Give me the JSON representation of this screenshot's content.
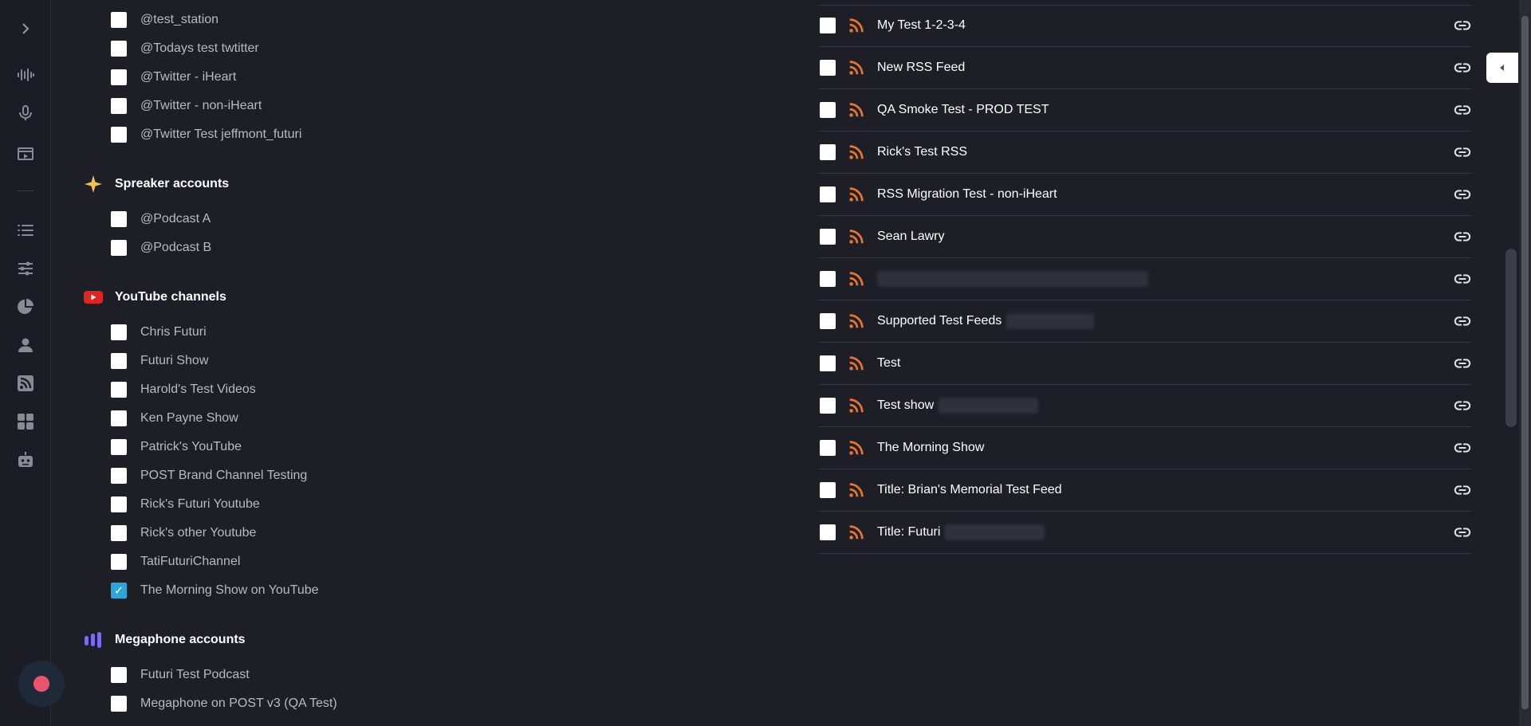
{
  "left_panel": {
    "twitter_items": [
      {
        "label": "@test_station",
        "checked": false
      },
      {
        "label": "@Todays test twtitter",
        "checked": false
      },
      {
        "label": "@Twitter - iHeart",
        "checked": false
      },
      {
        "label": "@Twitter - non-iHeart",
        "checked": false
      },
      {
        "label": "@Twitter Test jeffmont_futuri",
        "checked": false
      }
    ],
    "spreaker": {
      "title": "Spreaker accounts",
      "icon": "spreaker-star-icon",
      "items": [
        {
          "label": "@Podcast A",
          "checked": false
        },
        {
          "label": "@Podcast B",
          "checked": false
        }
      ]
    },
    "youtube": {
      "title": "YouTube channels",
      "icon": "youtube-icon",
      "items": [
        {
          "label": "Chris Futuri",
          "checked": false
        },
        {
          "label": "Futuri Show",
          "checked": false
        },
        {
          "label": "Harold's Test Videos",
          "checked": false
        },
        {
          "label": "Ken Payne Show",
          "checked": false
        },
        {
          "label": "Patrick's YouTube",
          "checked": false
        },
        {
          "label": "POST Brand Channel Testing",
          "checked": false
        },
        {
          "label": "Rick's Futuri Youtube",
          "checked": false
        },
        {
          "label": "Rick's other Youtube",
          "checked": false
        },
        {
          "label": "TatiFuturiChannel",
          "checked": false
        },
        {
          "label": "The Morning Show on YouTube",
          "checked": true
        }
      ]
    },
    "megaphone": {
      "title": "Megaphone accounts",
      "icon": "megaphone-bars-icon",
      "items": [
        {
          "label": "Futuri Test Podcast",
          "checked": false
        },
        {
          "label": "Megaphone on POST v3 (QA Test)",
          "checked": false
        }
      ]
    }
  },
  "rss_feeds": [
    {
      "name": "My Test 1-2-3-4",
      "redacted": false
    },
    {
      "name": "New RSS Feed",
      "redacted": false
    },
    {
      "name": "QA Smoke Test - PROD TEST",
      "redacted": false
    },
    {
      "name": "Rick's Test RSS",
      "redacted": false
    },
    {
      "name": "RSS Migration Test - non-iHeart",
      "redacted": false
    },
    {
      "name": "Sean Lawry",
      "redacted": false
    },
    {
      "name": "",
      "redacted": true
    },
    {
      "name": "Supported Test Feeds",
      "redacted": true
    },
    {
      "name": "Test",
      "redacted": false
    },
    {
      "name": "Test show",
      "redacted": true
    },
    {
      "name": "The Morning Show",
      "redacted": false
    },
    {
      "name": "Title: Brian's Memorial Test Feed",
      "redacted": false
    },
    {
      "name": "Title: Futuri",
      "redacted": true
    }
  ],
  "colors": {
    "background": "#1e1e27",
    "rss_orange": "#e8752f",
    "checked_blue": "#29a8d8",
    "record_red": "#e9556a"
  },
  "sidebar_icons": [
    "expand-chevron-icon",
    "waveform-icon",
    "microphone-icon",
    "video-icon",
    "list-icon",
    "sliders-icon",
    "pie-chart-icon",
    "user-icon",
    "rss-icon",
    "apps-grid-icon",
    "robot-icon"
  ]
}
